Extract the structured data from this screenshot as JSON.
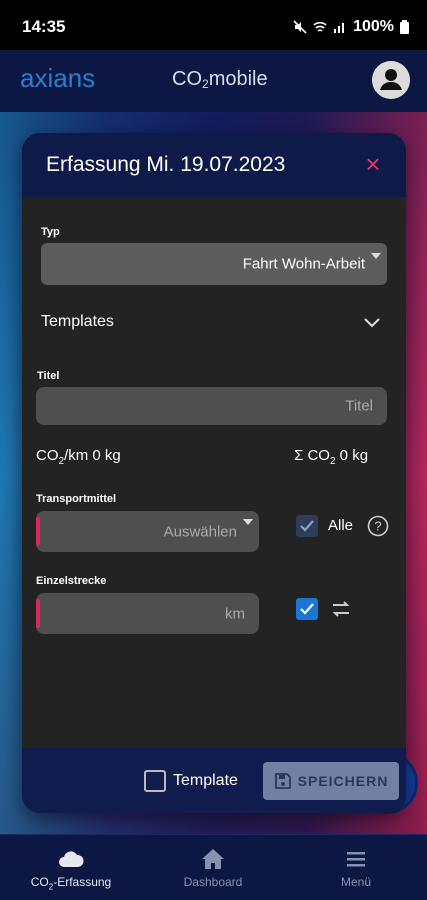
{
  "status_bar": {
    "time": "14:35",
    "battery": "100%"
  },
  "app": {
    "logo_text": "axians",
    "title_prefix": "CO",
    "title_sub": "2",
    "title_suffix": "mobile"
  },
  "dialog": {
    "title": "Erfassung Mi. 19.07.2023",
    "close_symbol": "×",
    "typ_label": "Typ",
    "typ_value": "Fahrt Wohn-Arbeit",
    "templates_label": "Templates",
    "titel_label": "Titel",
    "titel_placeholder": "Titel",
    "co2_km_prefix": "CO",
    "co2_km_sub": "2",
    "co2_km_suffix": "/km 0 kg",
    "co2_sum_prefix": "Σ CO",
    "co2_sum_sub": "2",
    "co2_sum_suffix": " 0 kg",
    "transport_label": "Transportmittel",
    "transport_placeholder": "Auswählen",
    "alle_label": "Alle",
    "einzel_label": "Einzelstrecke",
    "km_placeholder": "km",
    "template_label": "Template",
    "save_label": "SPEICHERN"
  },
  "bottom_nav": [
    {
      "label_prefix": "CO",
      "label_sub": "2",
      "label_suffix": "-Erfassung",
      "icon": "cloud-icon",
      "active": true
    },
    {
      "label": "Dashboard",
      "icon": "home-icon",
      "active": false
    },
    {
      "label": "Menü",
      "icon": "hamburger-menu-icon",
      "active": false
    }
  ],
  "colors": {
    "accent_pink": "#e8336a",
    "primary_blue": "#1976d2",
    "header_navy": "#0c1843"
  }
}
